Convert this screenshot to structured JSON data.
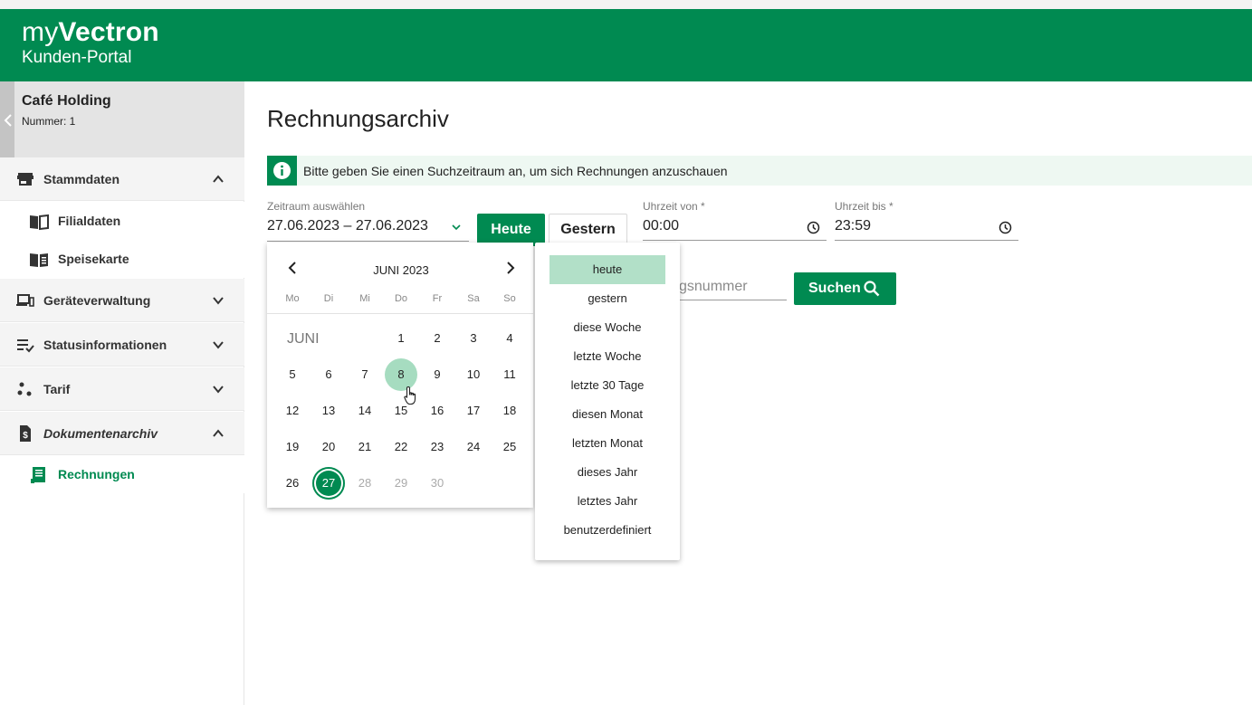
{
  "header": {
    "brand_prefix": "my",
    "brand_name": "Vectron",
    "subtitle": "Kunden-Portal"
  },
  "company": {
    "name": "Café Holding",
    "number": "Nummer: 1"
  },
  "sidebar": {
    "items": [
      {
        "label": "Stammdaten",
        "icon": "store-icon",
        "expanded": true
      },
      {
        "label": "Filialdaten",
        "icon": "book-open-icon"
      },
      {
        "label": "Speisekarte",
        "icon": "menu-book-icon"
      },
      {
        "label": "Geräteverwaltung",
        "icon": "devices-icon",
        "expanded": false
      },
      {
        "label": "Statusinformationen",
        "icon": "checklist-icon",
        "expanded": false
      },
      {
        "label": "Tarif",
        "icon": "scatter-dots-icon",
        "expanded": false
      },
      {
        "label": "Dokumentenarchiv",
        "icon": "document-dollar-icon",
        "expanded": true
      },
      {
        "label": "Rechnungen",
        "icon": "receipt-icon",
        "active": true
      }
    ]
  },
  "main": {
    "title": "Rechnungsarchiv",
    "info": "Bitte geben Sie einen Suchzeitraum an, um sich Rechnungen anzuschauen",
    "range": {
      "label": "Zeitraum auswählen",
      "value": "27.06.2023 – 27.06.2023"
    },
    "btn_today": "Heute",
    "btn_yesterday": "Gestern",
    "time_from": {
      "label": "Uhrzeit von *",
      "value": "00:00"
    },
    "time_to": {
      "label": "Uhrzeit bis *",
      "value": "23:59"
    },
    "invoice_number_visible": "gsnummer",
    "btn_search": "Suchen"
  },
  "calendar": {
    "title": "JUNI 2023",
    "month_label": "JUNI",
    "weekdays": [
      "Mo",
      "Di",
      "Mi",
      "Do",
      "Fr",
      "Sa",
      "So"
    ],
    "days": [
      "1",
      "2",
      "3",
      "4",
      "5",
      "6",
      "7",
      "8",
      "9",
      "10",
      "11",
      "12",
      "13",
      "14",
      "15",
      "16",
      "17",
      "18",
      "19",
      "20",
      "21",
      "22",
      "23",
      "24",
      "25",
      "26",
      "27",
      "28",
      "29",
      "30"
    ],
    "hover_day": "8",
    "selected_day": "27",
    "disabled_from": "28"
  },
  "quick_ranges": [
    "heute",
    "gestern",
    "diese Woche",
    "letzte Woche",
    "letzte 30 Tage",
    "diesen Monat",
    "letzten Monat",
    "dieses Jahr",
    "letztes Jahr",
    "benutzerdefiniert"
  ],
  "quick_active": "heute",
  "colors": {
    "brand_green": "#008a51",
    "hover_green": "#a6dcc0",
    "info_bg": "#eef8f2"
  }
}
